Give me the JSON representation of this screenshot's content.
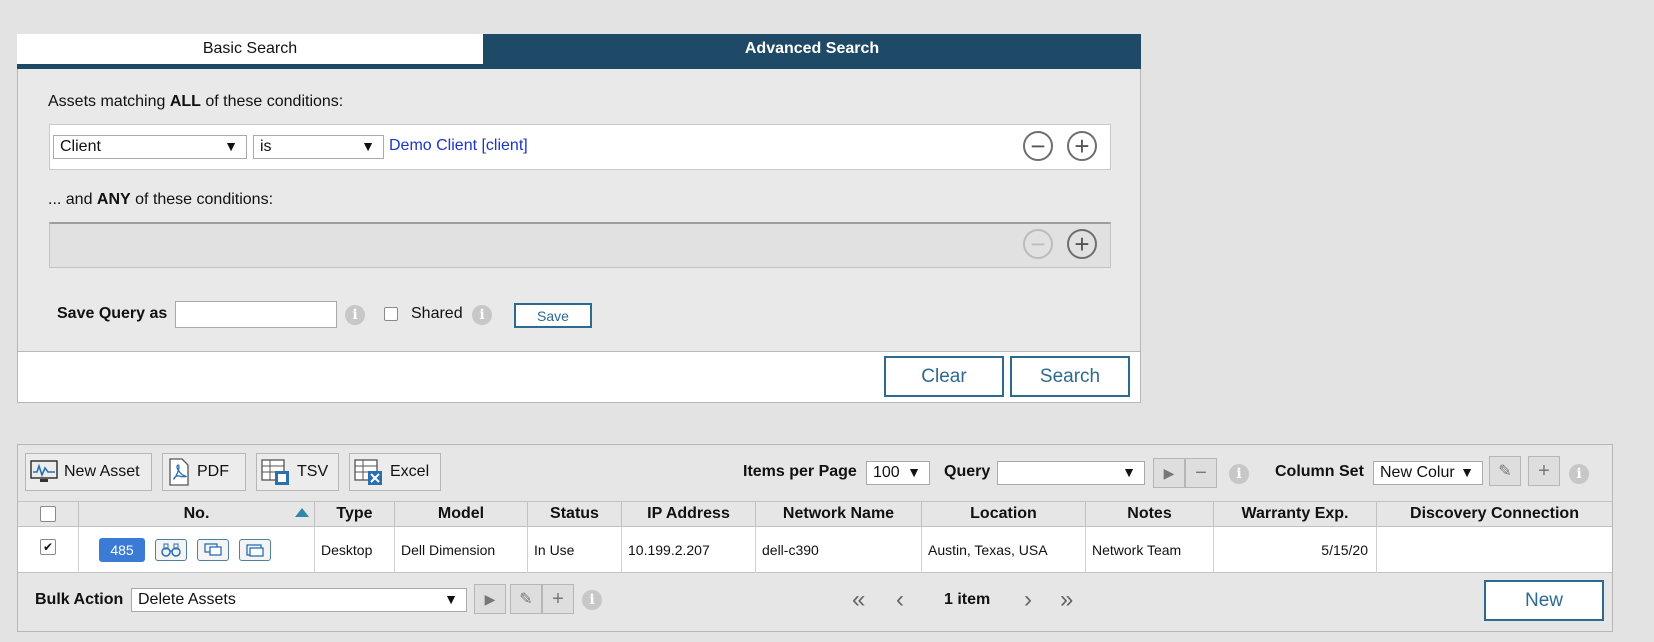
{
  "tabs": {
    "basic": "Basic Search",
    "advanced": "Advanced Search"
  },
  "conditions": {
    "all_prefix": "Assets matching ",
    "all_bold": "ALL",
    "all_suffix": " of these conditions:",
    "field": "Client",
    "operator": "is",
    "value": "Demo Client [client]",
    "any_prefix": "... and ",
    "any_bold": "ANY",
    "any_suffix": " of these conditions:"
  },
  "save_query": {
    "label": "Save Query as",
    "value": "",
    "shared_label": "Shared",
    "save_button": "Save"
  },
  "actions": {
    "clear": "Clear",
    "search": "Search"
  },
  "toolbar": {
    "new_asset": "New Asset",
    "pdf": "PDF",
    "tsv": "TSV",
    "excel": "Excel",
    "items_per_page_label": "Items per Page",
    "items_per_page": "100",
    "query_label": "Query",
    "query_value": "",
    "column_set_label": "Column Set",
    "column_set_value": "New Colur"
  },
  "table": {
    "columns": [
      "No.",
      "Type",
      "Model",
      "Status",
      "IP Address",
      "Network Name",
      "Location",
      "Notes",
      "Warranty Exp.",
      "Discovery Connection"
    ],
    "rows": [
      {
        "no": "485",
        "type": "Desktop",
        "model": "Dell Dimension",
        "status": "In Use",
        "ip": "10.199.2.207",
        "network_name": "dell-c390",
        "location": "Austin, Texas, USA",
        "notes": "Network Team",
        "warranty": "5/15/20",
        "discovery": ""
      }
    ]
  },
  "bulk": {
    "label": "Bulk Action",
    "value": "Delete Assets",
    "page_info": "1 item",
    "new_button": "New"
  },
  "colors": {
    "accent": "#1f4a67",
    "link": "#1a35c9",
    "outline": "#2c6a90",
    "pill": "#3b7bd6"
  },
  "icons": [
    "chevron-down-icon",
    "minus-circle-icon",
    "plus-circle-icon",
    "info-icon",
    "monitor-chart-icon",
    "pdf-icon",
    "tsv-icon",
    "excel-icon",
    "play-icon",
    "minus-icon",
    "pencil-icon",
    "plus-icon",
    "sort-up-icon",
    "binoculars-icon",
    "remote-icon",
    "window-icon",
    "double-left-icon",
    "left-icon",
    "right-icon",
    "double-right-icon"
  ]
}
